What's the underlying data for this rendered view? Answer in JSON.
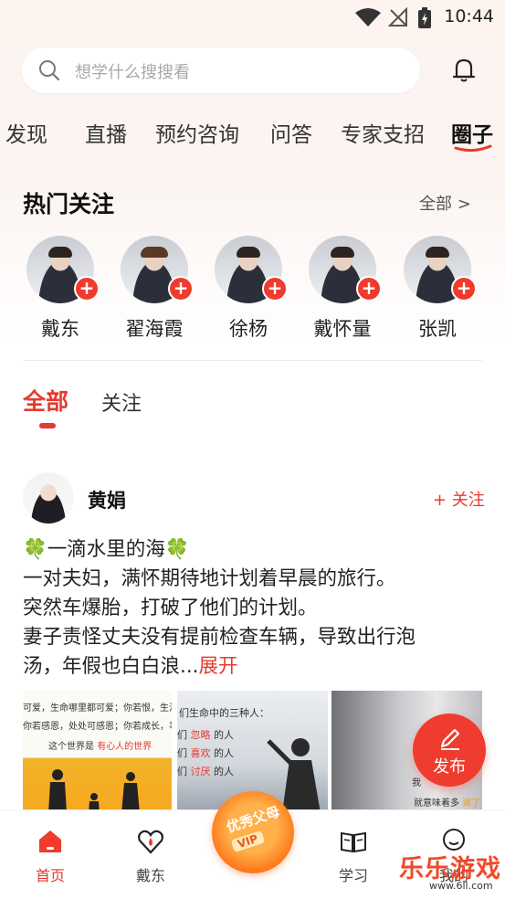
{
  "status_bar": {
    "time": "10:44"
  },
  "search": {
    "placeholder": "想学什么搜搜看"
  },
  "tabs": [
    {
      "label": "发现"
    },
    {
      "label": "直播"
    },
    {
      "label": "预约咨询"
    },
    {
      "label": "问答"
    },
    {
      "label": "专家支招"
    },
    {
      "label": "圈子",
      "active": true
    }
  ],
  "hot_follow": {
    "title": "热门关注",
    "see_all": "全部 >",
    "experts": [
      {
        "name": "戴东"
      },
      {
        "name": "翟海霞"
      },
      {
        "name": "徐杨"
      },
      {
        "name": "戴怀量"
      },
      {
        "name": "张凯"
      }
    ],
    "plus": "+"
  },
  "sub_tabs": {
    "all": "全部",
    "following": "关注"
  },
  "post": {
    "author": "黄娟",
    "follow_label": "+ 关注",
    "title_emoji": "🍀",
    "title": "一滴水里的海",
    "lines": [
      "一对夫妇，满怀期待地计划着早晨的旅行。",
      "突然车爆胎，打破了他们的计划。",
      "妻子责怪丈夫没有提前检查车辆，导致出行泡",
      "汤，年假也白白浪..."
    ],
    "expand": "展开",
    "images": [
      {
        "lines": [
          "可爱，生命哪里都可爱；你若恨，生活哪里都可",
          "你若感恩，处处可感恩；你若成长，事事可成长"
        ],
        "highlight_prefix": "这个世界是",
        "highlight": "有心人的世界"
      },
      {
        "heading": "们生命中的三种人：",
        "rows": [
          {
            "pre": "们",
            "word": "忽略",
            "post": "的人"
          },
          {
            "pre": "们",
            "word": "喜欢",
            "post": "的人"
          },
          {
            "pre": "们",
            "word": "讨厌",
            "post": "的人"
          }
        ]
      },
      {
        "lines": [
          "我",
          "就意味着多"
        ],
        "highlight": "谢了"
      }
    ]
  },
  "fab": {
    "label": "发布"
  },
  "bottom_nav": [
    {
      "label": "首页",
      "icon": "home-icon",
      "active": true
    },
    {
      "label": "戴东",
      "icon": "heart-drop-icon"
    },
    {
      "label": "优秀父母",
      "icon": "vip-badge",
      "vip": "VIP"
    },
    {
      "label": "学习",
      "icon": "book-icon"
    },
    {
      "label": "我的",
      "icon": "profile-icon"
    }
  ],
  "watermark": {
    "text": "乐乐游戏",
    "sub": "www.6ll.com"
  },
  "colors": {
    "accent": "#e53a2f",
    "fab": "#ef3c2e",
    "badge": "#ff7a1c"
  }
}
